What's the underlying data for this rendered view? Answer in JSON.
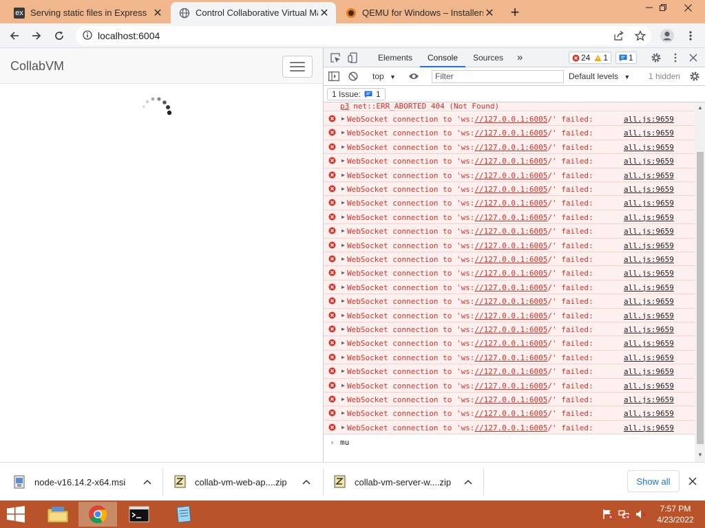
{
  "browser": {
    "tabs": [
      {
        "label": "Serving static files in Express",
        "favicon": "express-favicon",
        "active": false
      },
      {
        "label": "Control Collaborative Virtual Ma",
        "favicon": "globe-icon",
        "active": true
      },
      {
        "label": "QEMU for Windows – Installers (",
        "favicon": "qemu-favicon",
        "active": false
      }
    ],
    "favicon_text": "ex",
    "new_tab_glyph": "+",
    "close_glyph": "✕",
    "url": "localhost:6004"
  },
  "page": {
    "brand": "CollabVM"
  },
  "devtools": {
    "tabs": [
      "Elements",
      "Console",
      "Sources"
    ],
    "active_tab": "Console",
    "more_tabs_glyph": "»",
    "error_count": "24",
    "warning_count": "1",
    "message_count": "1",
    "context": "top",
    "filter_placeholder": "Filter",
    "levels": "Default levels",
    "hidden": "1 hidden",
    "issues_label": "1 Issue:",
    "issues_count": "1",
    "prev_line": {
      "source": "p3",
      "text": "net::ERR_ABORTED 404 (Not Found)"
    },
    "error_prefix": "WebSocket connection to 'ws:",
    "error_url": "//127.0.0.1:6005",
    "error_suffix": "/' failed:",
    "error_location": "all.js:9659",
    "error_repeat": 23,
    "prompt_text": "mu"
  },
  "downloads": {
    "items": [
      {
        "name": "node-v16.14.2-x64.msi",
        "icon": "msi-file-icon"
      },
      {
        "name": "collab-vm-web-ap....zip",
        "icon": "zip-file-icon"
      },
      {
        "name": "collab-vm-server-w....zip",
        "icon": "zip-file-icon"
      }
    ],
    "show_all": "Show all"
  },
  "taskbar": {
    "time": "7:57 PM",
    "date": "4/23/2022",
    "colors": {
      "bar": "#b9542a",
      "tabstrip": "#f0b68c"
    }
  }
}
